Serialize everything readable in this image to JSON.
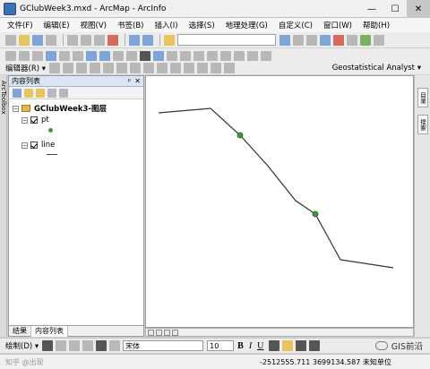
{
  "window": {
    "title": "GClubWeek3.mxd - ArcMap - ArcInfo",
    "controls": [
      "—",
      "☐",
      "✕"
    ]
  },
  "menu": [
    "文件(F)",
    "编辑(E)",
    "视图(V)",
    "书签(B)",
    "插入(I)",
    "选择(S)",
    "地理处理(G)",
    "自定义(C)",
    "窗口(W)",
    "帮助(H)"
  ],
  "toolbars": {
    "editor_label": "编辑器(R) ▾",
    "geostat_label": "Geostatistical Analyst ▾"
  },
  "toc": {
    "title": "内容列表",
    "pin": "ᵖ",
    "close": "✕",
    "dataframe": "GClubWeek3-图层",
    "layers": [
      {
        "name": "pt",
        "symbol": "point"
      },
      {
        "name": "line",
        "symbol": "line"
      }
    ],
    "tabs": [
      "结果",
      "内容列表"
    ]
  },
  "left_strip_label": "ArcToolbox",
  "right_strip_labels": [
    "目录",
    "搜索"
  ],
  "drawbar": {
    "draw_label": "绘制(D) ▾",
    "font": "宋体",
    "size": "10",
    "bold": "B",
    "italic": "I",
    "underline": "U"
  },
  "brand": "GIS前沿",
  "watermark": "知乎 @出现",
  "status": {
    "coordinates": "-2512555.711  3699134.587 未知单位"
  },
  "map": {
    "line_color": "#333333",
    "point_color": "#3a9a3a"
  }
}
